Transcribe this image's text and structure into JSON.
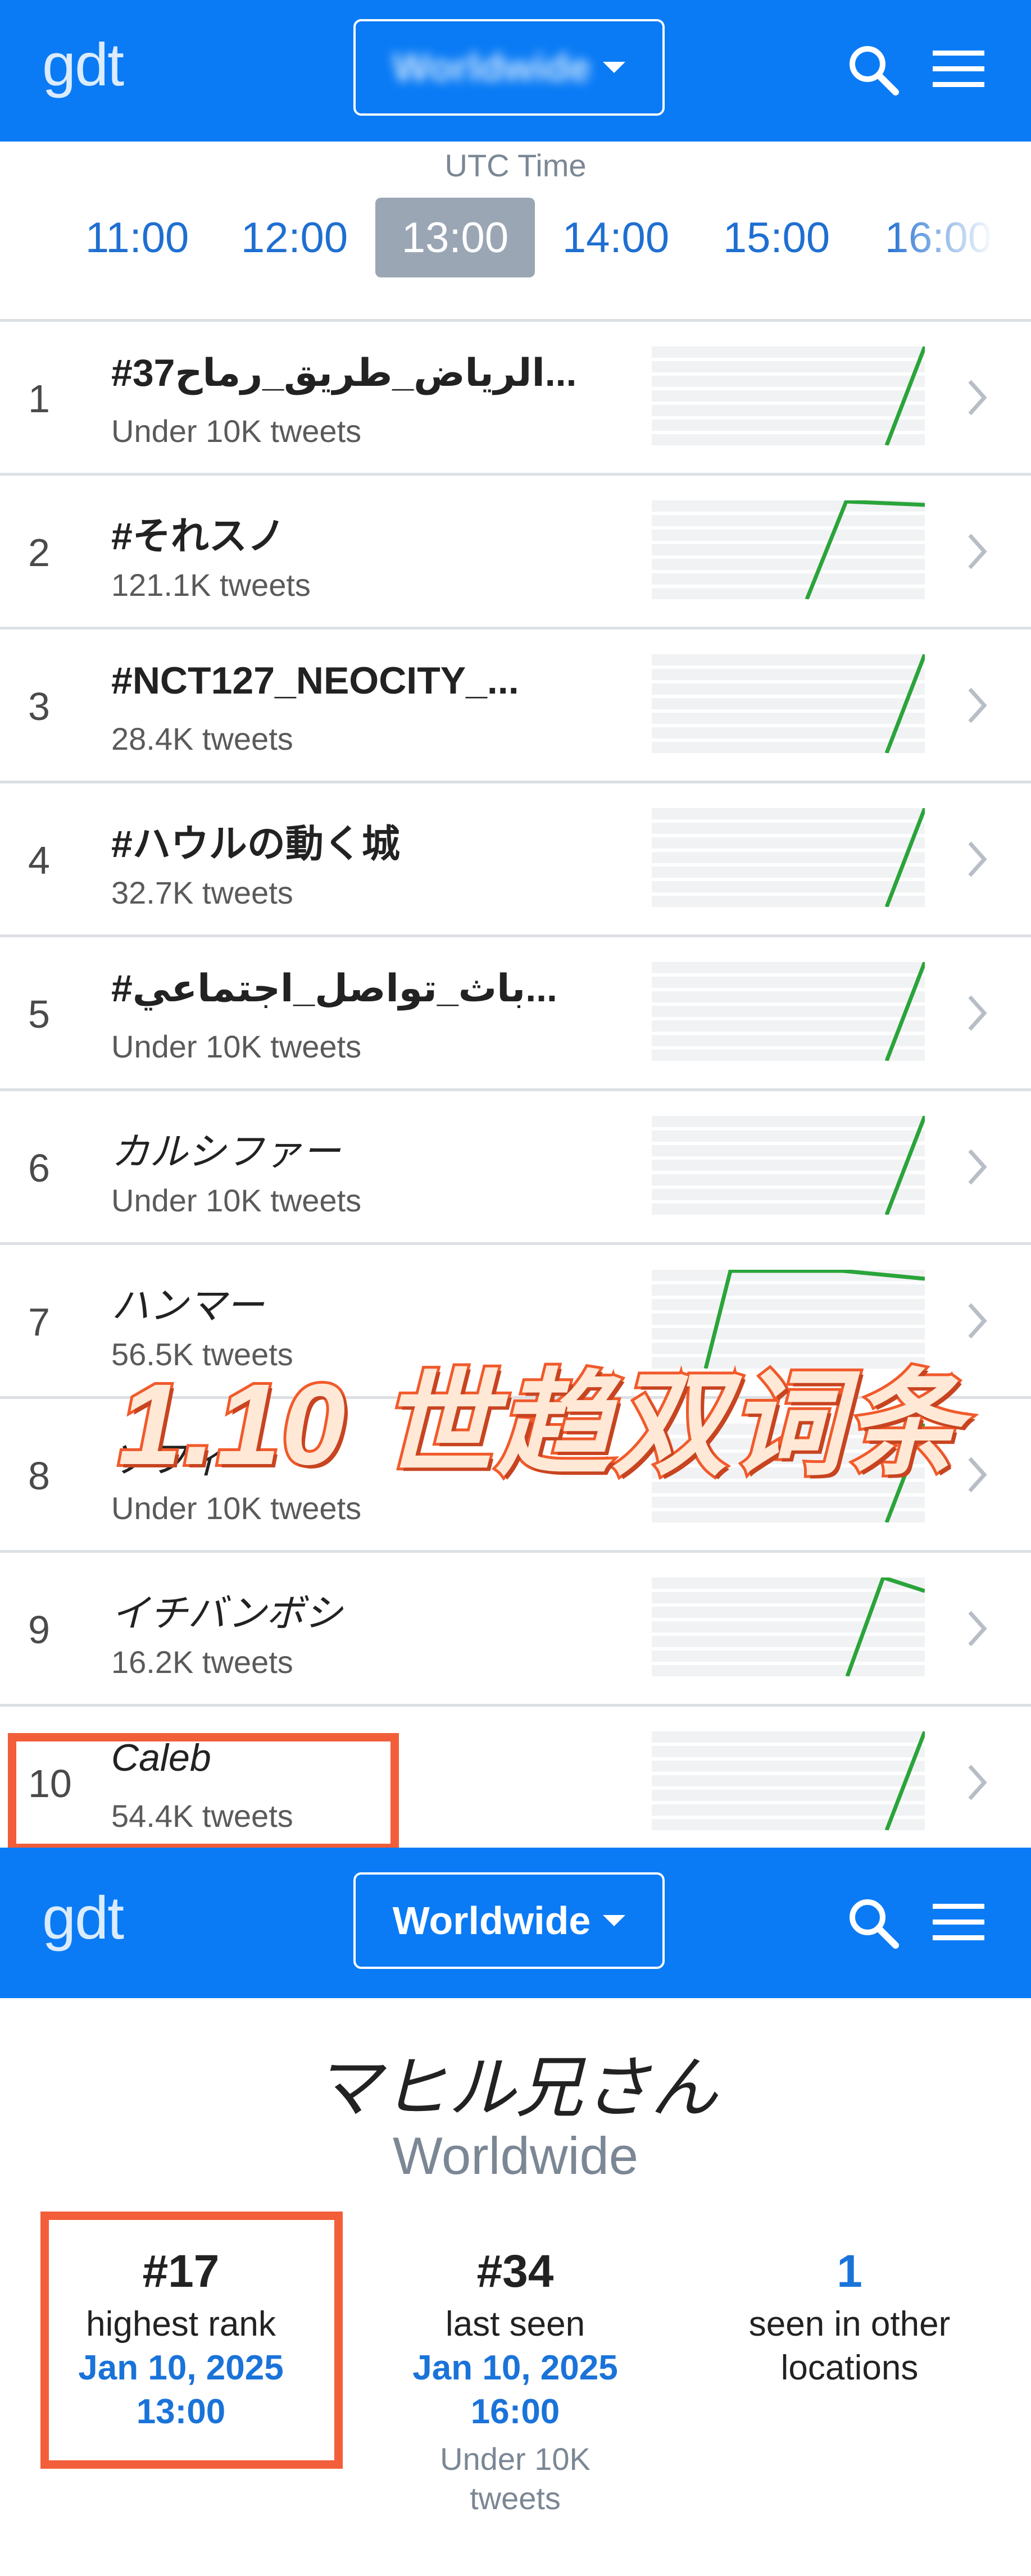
{
  "top_nav": {
    "logo": "gdt",
    "location_select": "Worldwide",
    "colors": {
      "bar": "#0a7bf5"
    }
  },
  "time_picker": {
    "label": "UTC Time",
    "hours": [
      "11:00",
      "12:00",
      "13:00",
      "14:00",
      "15:00",
      "16:00"
    ],
    "selected": "13:00"
  },
  "trends": [
    {
      "rank": "1",
      "name": "#37الرياض_طريق_رماح...",
      "count": "Under 10K tweets",
      "italic": false,
      "spark": "rise"
    },
    {
      "rank": "2",
      "name": "#それスノ",
      "count": "121.1K tweets",
      "italic": false,
      "spark": "plateau"
    },
    {
      "rank": "3",
      "name": "#NCT127_NEOCITY_...",
      "count": "28.4K tweets",
      "italic": false,
      "spark": "rise"
    },
    {
      "rank": "4",
      "name": "#ハウルの動く城",
      "count": "32.7K tweets",
      "italic": false,
      "spark": "rise"
    },
    {
      "rank": "5",
      "name": "#باث_تواصل_اجتماعي...",
      "count": "Under 10K tweets",
      "italic": false,
      "spark": "rise"
    },
    {
      "rank": "6",
      "name": "カルシファー",
      "count": "Under 10K tweets",
      "italic": true,
      "spark": "rise"
    },
    {
      "rank": "7",
      "name": "ハンマー",
      "count": "56.5K tweets",
      "italic": true,
      "spark": "plateau_long"
    },
    {
      "rank": "8",
      "name": "ソフィー",
      "count": "Under 10K tweets",
      "italic": true,
      "spark": "rise"
    },
    {
      "rank": "9",
      "name": "イチバンボシ",
      "count": "16.2K tweets",
      "italic": true,
      "spark": "peak"
    },
    {
      "rank": "10",
      "name": "Caleb",
      "count": "54.4K tweets",
      "italic": true,
      "spark": "rise"
    }
  ],
  "overlay_caption": "1.10 世趋双词条",
  "second_nav": {
    "logo": "gdt",
    "location_select": "Worldwide"
  },
  "detail": {
    "title": "マヒル兄さん",
    "location": "Worldwide",
    "stats": [
      {
        "value": "#17",
        "label": "highest rank",
        "date": "Jan 10, 2025",
        "time": "13:00",
        "sub": ""
      },
      {
        "value": "#34",
        "label": "last seen",
        "date": "Jan 10, 2025",
        "time": "16:00",
        "sub": "Under 10K tweets"
      },
      {
        "value": "1",
        "label": "seen in other locations",
        "date": "",
        "time": "",
        "sub": ""
      }
    ]
  },
  "colors": {
    "accent_blue": "#0a7bf5",
    "link_blue": "#1a73d9",
    "spark_green": "#2aa43a",
    "highlight": "#f25e3a"
  }
}
